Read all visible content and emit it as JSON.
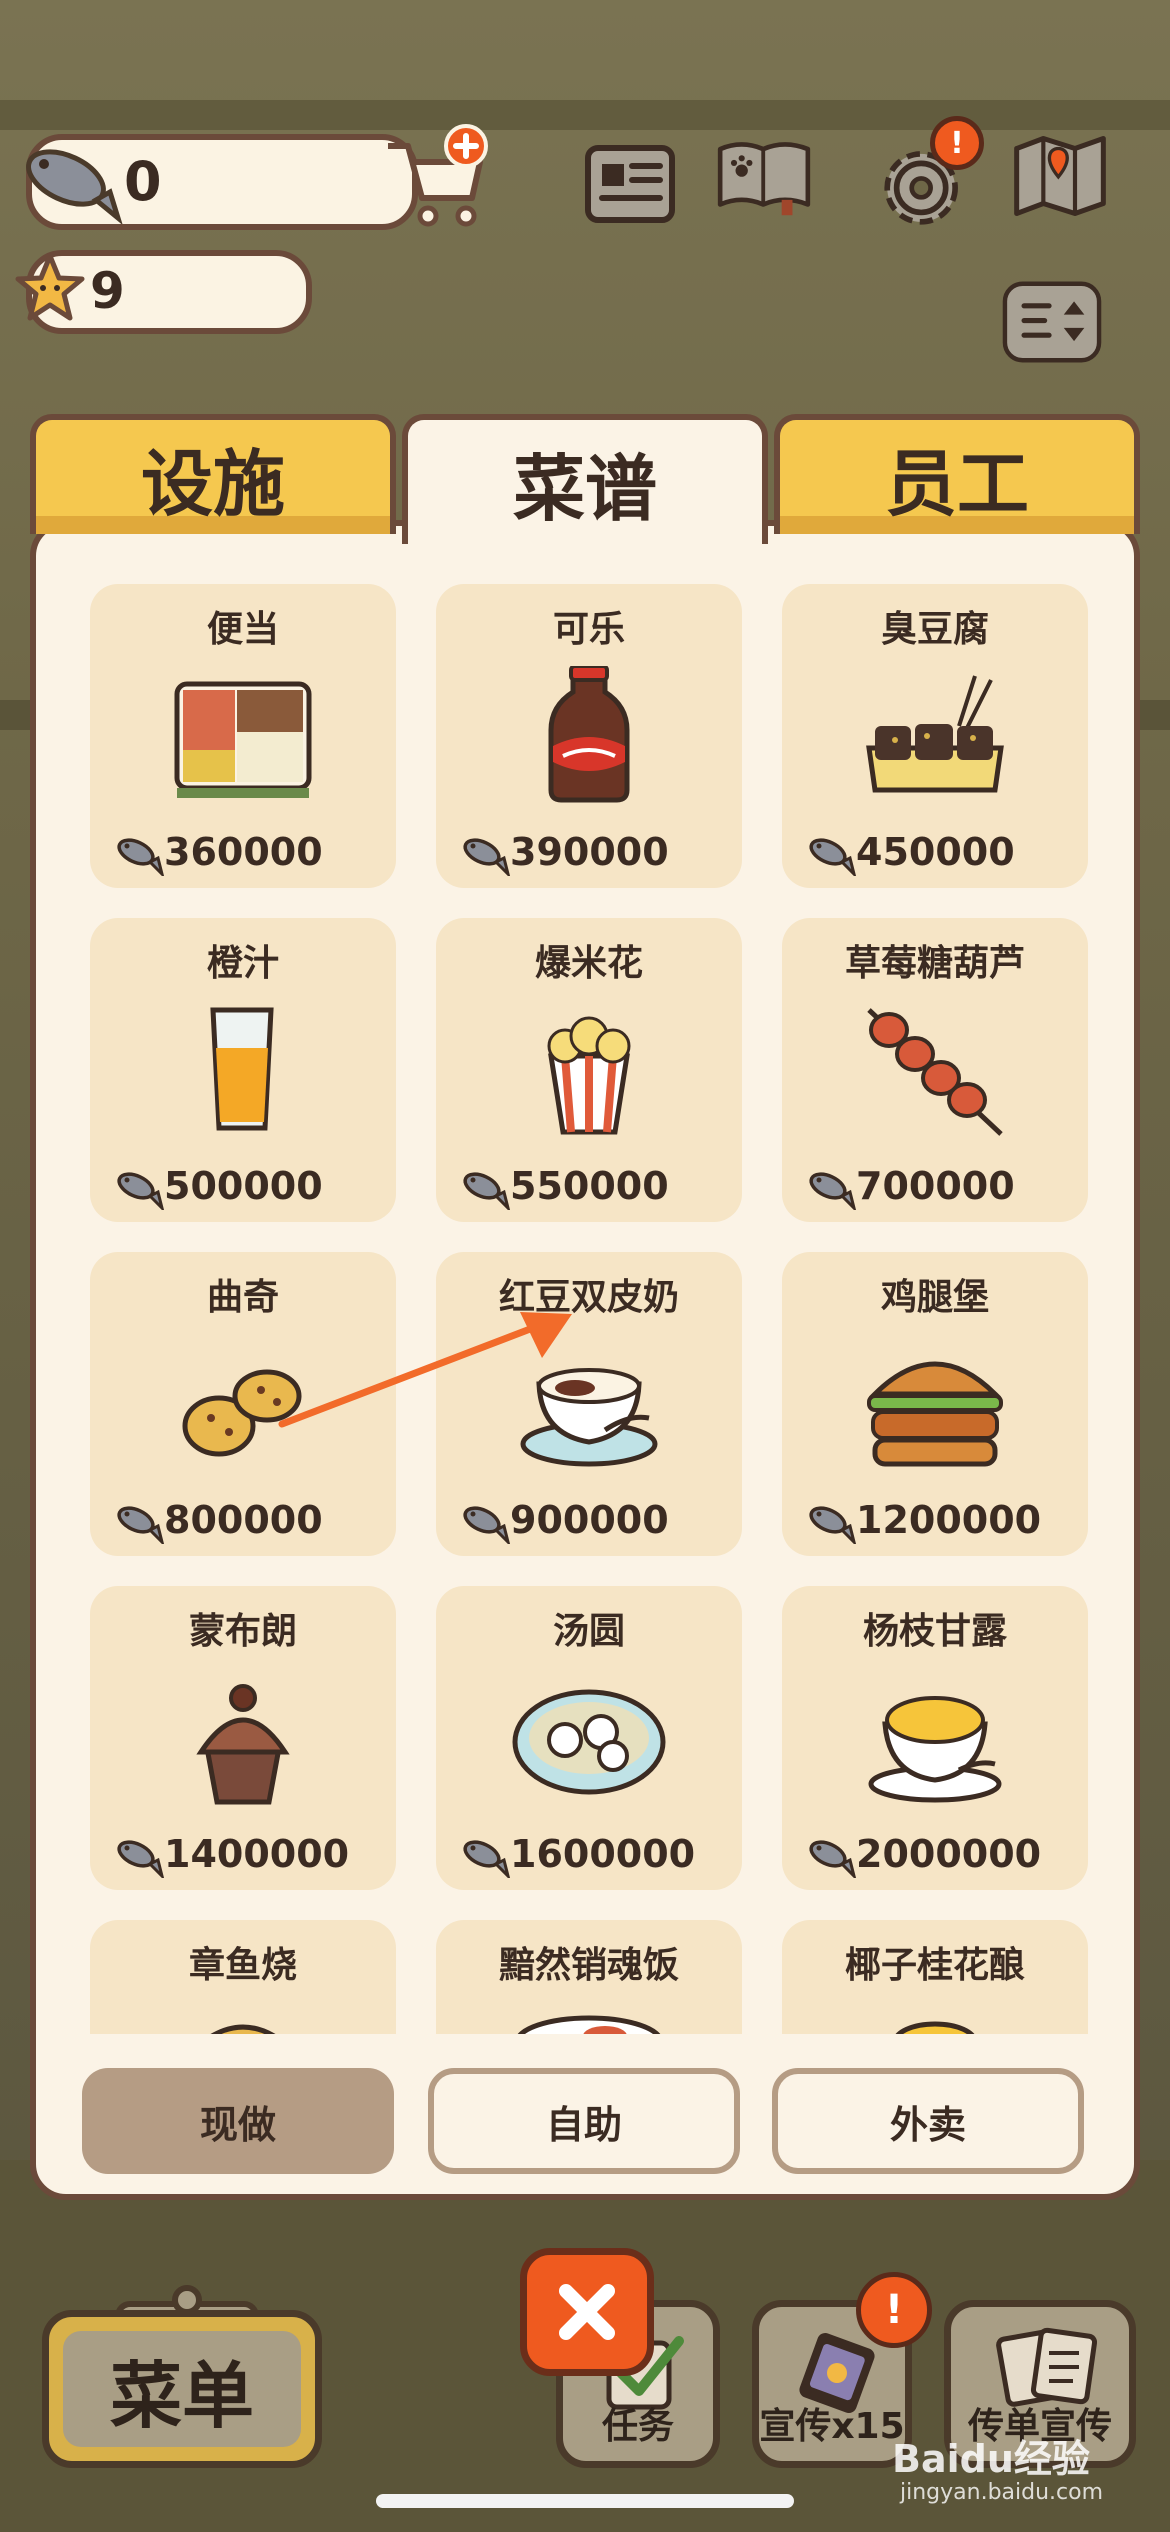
{
  "currency": {
    "fish": "0",
    "stars": "9"
  },
  "tabs": [
    {
      "label": "设施",
      "active": false
    },
    {
      "label": "菜谱",
      "active": true
    },
    {
      "label": "员工",
      "active": false
    }
  ],
  "recipes": [
    {
      "name": "便当",
      "price": "360000",
      "icon": "bento-icon"
    },
    {
      "name": "可乐",
      "price": "390000",
      "icon": "cola-icon"
    },
    {
      "name": "臭豆腐",
      "price": "450000",
      "icon": "stinky-tofu-icon"
    },
    {
      "name": "橙汁",
      "price": "500000",
      "icon": "orange-juice-icon"
    },
    {
      "name": "爆米花",
      "price": "550000",
      "icon": "popcorn-icon"
    },
    {
      "name": "草莓糖葫芦",
      "price": "700000",
      "icon": "candied-strawberry-icon"
    },
    {
      "name": "曲奇",
      "price": "800000",
      "icon": "cookie-icon"
    },
    {
      "name": "红豆双皮奶",
      "price": "900000",
      "icon": "red-bean-pudding-icon"
    },
    {
      "name": "鸡腿堡",
      "price": "1200000",
      "icon": "burger-icon"
    },
    {
      "name": "蒙布朗",
      "price": "1400000",
      "icon": "mont-blanc-icon"
    },
    {
      "name": "汤圆",
      "price": "1600000",
      "icon": "tangyuan-icon"
    },
    {
      "name": "杨枝甘露",
      "price": "2000000",
      "icon": "mango-dessert-icon"
    },
    {
      "name": "章鱼烧",
      "price": "",
      "icon": "takoyaki-icon"
    },
    {
      "name": "黯然销魂饭",
      "price": "",
      "icon": "rice-bowl-icon"
    },
    {
      "name": "椰子桂花酿",
      "price": "",
      "icon": "coconut-drink-icon"
    }
  ],
  "modes": [
    {
      "label": "现做",
      "selected": true
    },
    {
      "label": "自助",
      "selected": false
    },
    {
      "label": "外卖",
      "selected": false
    }
  ],
  "bottom_bar": {
    "menu": "菜单",
    "tasks": "任务",
    "promote": "宣传x15",
    "flyer": "传单宣传",
    "badge": "!"
  },
  "watermark": {
    "brand": "Baidu经验",
    "url": "jingyan.baidu.com"
  },
  "colors": {
    "tab_inactive": "#f5c84f",
    "card_bg": "#f6e5c6",
    "close_button": "#ef5a1f",
    "arrow": "#f26b2a"
  }
}
